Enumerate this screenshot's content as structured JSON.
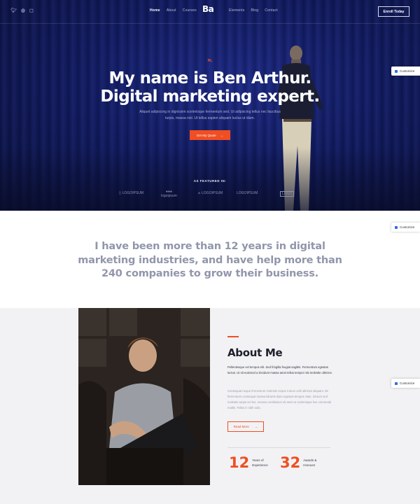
{
  "header": {
    "social_icons": [
      "twitter-icon",
      "dribbble-icon",
      "instagram-icon"
    ],
    "nav_left": [
      "Home",
      "About",
      "Courses"
    ],
    "logo": "Ba",
    "nav_right": [
      "Elements",
      "Blog",
      "Contact"
    ],
    "cta_label": "Enroll Today"
  },
  "hero": {
    "kicker": "Hi,",
    "headline_line1": "My name is Ben Arthur.",
    "headline_line2": "Digital marketing expert.",
    "subtitle": "Aliquet adipiscing in dignissim scelerisque fermentum sed. Ut adipiscing tellus nec faucibus turpis, massa nisl. Ut tellus sapien aliquam luctus ut diam.",
    "button_label": "Get My Quote",
    "featured_label": "AS FEATURED IN:",
    "brands": [
      "LOGOIPSUM",
      "logoipsum",
      "LOGOIPSUM",
      "LOGOIPSUM",
      "LOGO"
    ]
  },
  "customize_label": "Customize",
  "quote": {
    "line1": "I have been more than 12 years in digital",
    "line2": "marketing industries, and have help more than",
    "line3": "240 companies to grow their business."
  },
  "about": {
    "title": "About Me",
    "bold_text": "Pellentesque vel tempus elit. Sed fringilla feugiat sagittis. Fermentum egestas luctus. Ut sit euismod a tincidunt massa amet tellus tempor nisi molestie ultricies.",
    "body_text": "Consequat neque fermentum molestie neque rutrum velit ultricies aliquam. Mi fermentum consequat massa lobortis diam egestas tempus vitae. Dictum sed molestie turpis vel leo. Aenean vestibulum sit amet ut scelerisque hac commodo mattis. Tellus in nibh odio.",
    "button_label": "Read More",
    "stats": [
      {
        "value": "12",
        "label_line1": "Years of",
        "label_line2": "Experience"
      },
      {
        "value": "32",
        "label_line1": "Awards &",
        "label_line2": "Honours"
      }
    ]
  },
  "colors": {
    "accent": "#f04e23",
    "hero_bg": "#111c66",
    "quote_text": "#9196ab"
  }
}
